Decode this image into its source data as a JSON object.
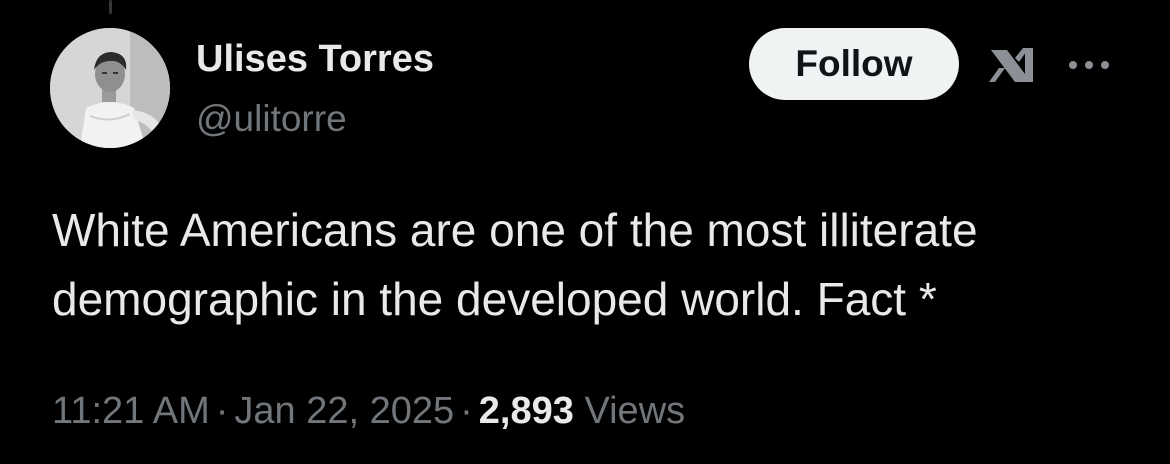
{
  "user": {
    "display_name": "Ulises Torres",
    "handle": "@ulitorre"
  },
  "actions": {
    "follow_label": "Follow",
    "grok_icon": "grok-icon",
    "more_icon": "more-icon"
  },
  "tweet": {
    "text": "White Americans are one of the most illiterate demographic in the developed world. Fact *"
  },
  "meta": {
    "time": "11:21 AM",
    "separator": "·",
    "date": "Jan 22, 2025",
    "views_count": "2,893",
    "views_label": "Views"
  },
  "colors": {
    "background": "#000000",
    "primary_text": "#e7e9ea",
    "secondary_text": "#71767b",
    "follow_bg": "#eff3f4",
    "follow_text": "#0f1419"
  }
}
